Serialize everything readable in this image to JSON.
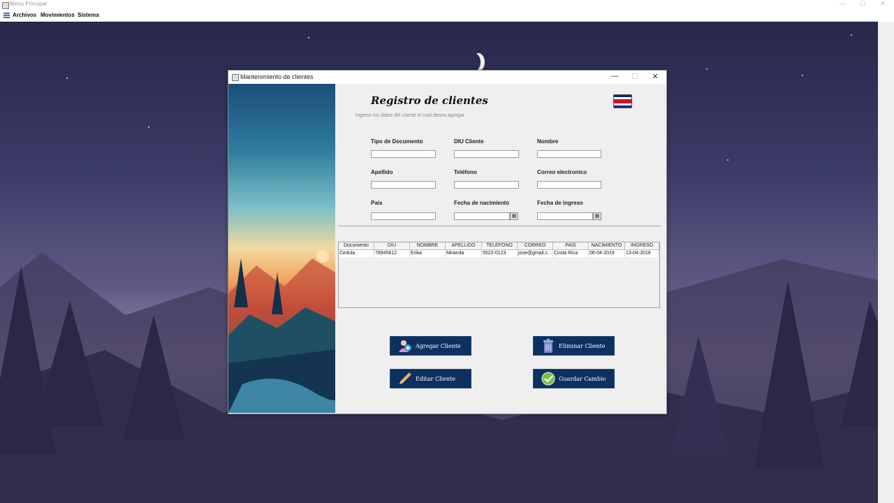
{
  "main_window": {
    "title": "Menú Principal",
    "controls": {
      "minimize": "—",
      "maximize": "☐",
      "close": "✕"
    }
  },
  "menubar": {
    "items": [
      "Archivos",
      "Movimientos",
      "Sistema"
    ]
  },
  "frame": {
    "title": "Mantenimiento de clientes",
    "controls": {
      "minimize": "—",
      "maximize": "☐",
      "close": "✕"
    }
  },
  "form": {
    "title": "Registro de clientes",
    "subtitle": "Ingrese los datos del cliente el cual desea agregar",
    "labels": {
      "tipo_documento": "Tipo de Documento",
      "diu_cliente": "DIU Cliente",
      "nombre": "Nombre",
      "apellido": "Apellido",
      "telefono": "Teléfono",
      "correo": "Correo electronico",
      "pais": "Pais",
      "fecha_nacimiento": "Fecha de nacimiento",
      "fecha_ingreso": "Fecha de ingreso"
    },
    "values": {
      "tipo_documento": "",
      "diu_cliente": "",
      "nombre": "",
      "apellido": "",
      "telefono": "",
      "correo": "",
      "pais": "",
      "fecha_nacimiento": "",
      "fecha_ingreso": ""
    }
  },
  "table": {
    "columns": [
      "Documento",
      "DIU",
      "NOMBRE",
      "APELLIDO",
      "TELÉFONO",
      "CORREO",
      "PAÍS",
      "NACIMIENTO",
      "INGRESO"
    ],
    "rows": [
      [
        "Cedula",
        "78945612",
        "Erika",
        "Miranda",
        "5522-0123",
        "jose@gmail.c...",
        "Costa  Rica",
        "06-04-2019",
        "13-04-2018"
      ]
    ]
  },
  "buttons": {
    "agregar": "Agregar Cliente",
    "eliminar": "Eliminar Cliente",
    "editar": "Editar Cliente",
    "guardar": "Guardar Cambio"
  },
  "colors": {
    "button_bg": "#0c3060",
    "flag_blue": "#002b7f",
    "flag_red": "#ce1126"
  },
  "icons": {
    "agregar": "add-user-icon",
    "eliminar": "trash-icon",
    "editar": "pencil-icon",
    "guardar": "check-circle-icon",
    "flag": "costa-rica-flag-icon"
  }
}
